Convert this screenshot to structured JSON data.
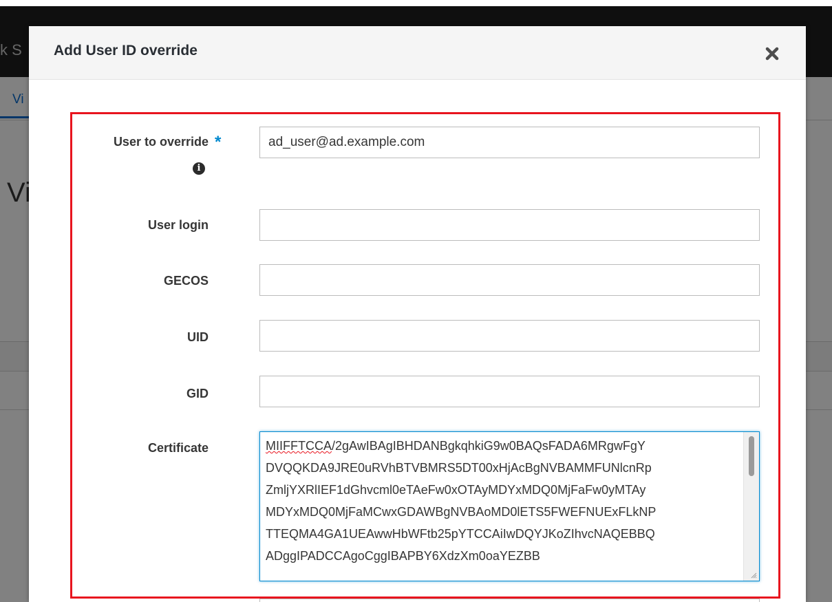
{
  "background": {
    "brand_fragment": "k S",
    "tab_fragment": "Vi",
    "heading_fragment": "Vi"
  },
  "modal": {
    "title": "Add User ID override",
    "close_icon": "close-x-icon"
  },
  "form": {
    "user_to_override": {
      "label": "User to override",
      "required_marker": "*",
      "info_icon": "info-circle-icon",
      "info_glyph": "i",
      "value": "ad_user@ad.example.com"
    },
    "user_login": {
      "label": "User login",
      "value": ""
    },
    "gecos": {
      "label": "GECOS",
      "value": ""
    },
    "uid": {
      "label": "UID",
      "value": ""
    },
    "gid": {
      "label": "GID",
      "value": ""
    },
    "certificate": {
      "label": "Certificate",
      "first_word_flagged": "MIIFFTCCA",
      "first_line_rest": "/2gAwIBAgIBHDANBgkqhkiG9w0BAQsFADA6MRgwFgY",
      "lines": [
        "DVQQKDA9JRE0uRVhBTVBMRS5DT00xHjAcBgNVBAMMFUNlcnRp",
        "ZmljYXRlIEF1dGhvcml0eTAeFw0xOTAyMDYxMDQ0MjFaFw0yMTAy",
        "MDYxMDQ0MjFaMCwxGDAWBgNVBAoMD0lETS5FWEFNUExFLkNP",
        "TTEQMA4GA1UEAwwHbWFtb25pYTCCAiIwDQYJKoZIhvcNAQEBBQ",
        "ADggIPADCCAgoCggIBAPBY6XdzXm0oaYEZBB"
      ]
    }
  },
  "colors": {
    "highlight_border": "#e8141e",
    "required_star": "#0088ce",
    "focus_border": "#0088ce",
    "tab_accent": "#0066cc"
  }
}
